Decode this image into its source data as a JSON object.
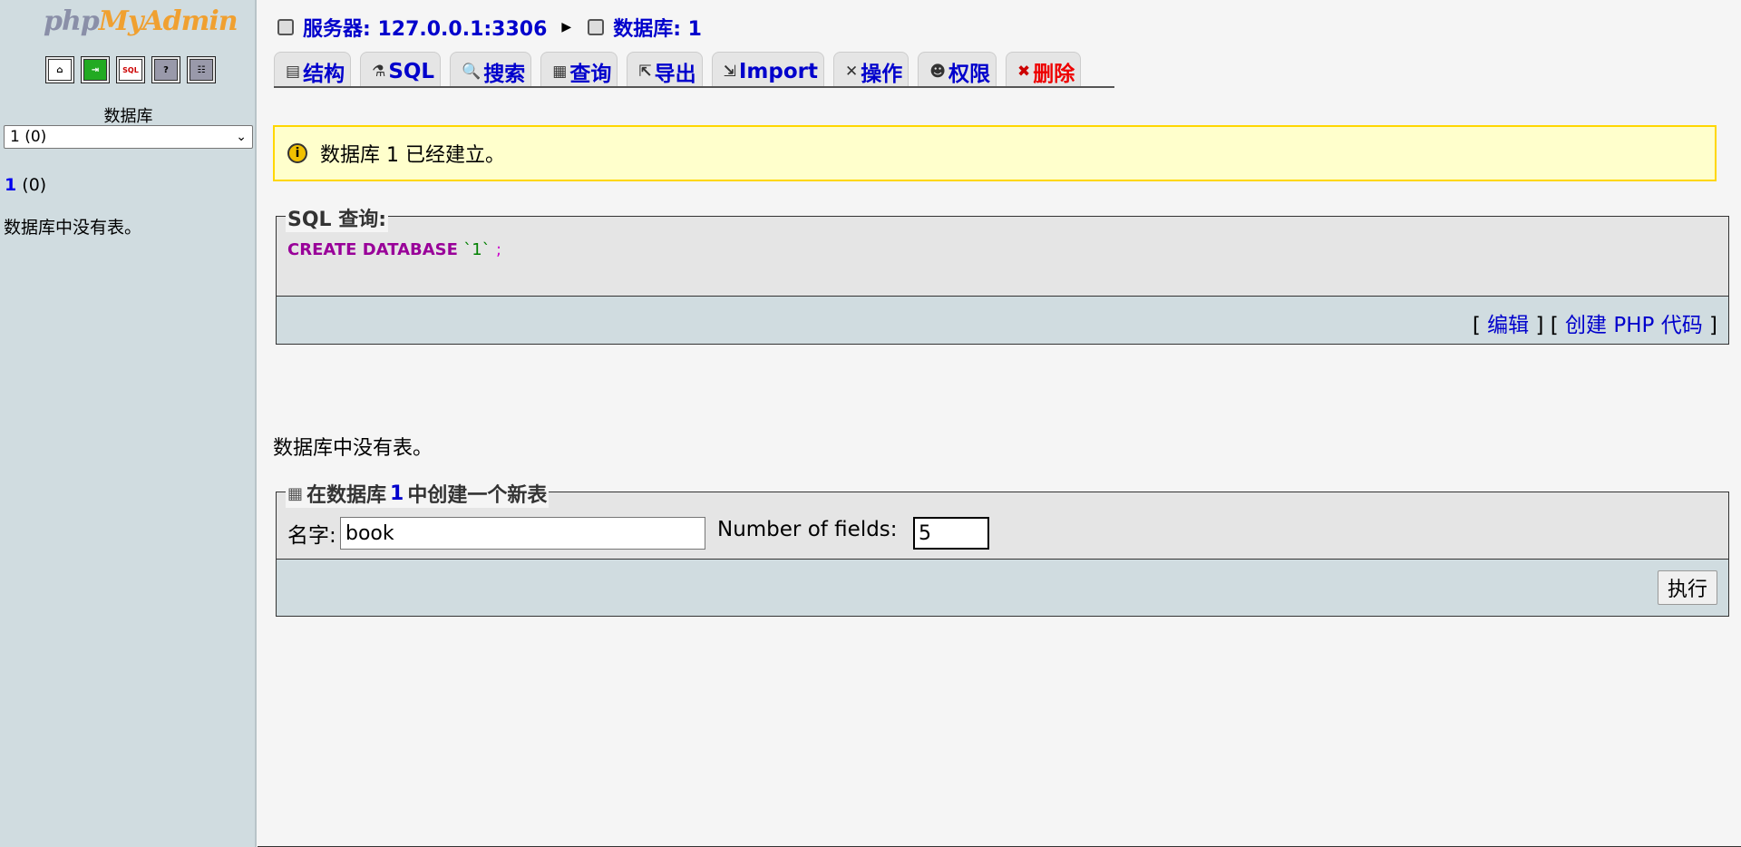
{
  "left": {
    "logo": {
      "php": "php",
      "myadmin": "MyAdmin"
    },
    "quick_icons": [
      "home-icon",
      "exit-icon",
      "sql-icon",
      "help-icon",
      "query-window-icon"
    ],
    "quick_icon_glyphs": [
      "⌂",
      "⇥",
      "SQL",
      "?",
      "☷"
    ],
    "db_label": "数据库",
    "db_select_value": "1 (0)",
    "db_link_name": "1",
    "db_link_count": "(0)",
    "empty_text": "数据库中没有表。"
  },
  "breadcrumb": {
    "server": "服务器: 127.0.0.1:3306",
    "database": "数据库: 1"
  },
  "tabs": [
    {
      "label": "结构",
      "icon": "structure-icon",
      "glyph": "▤"
    },
    {
      "label": "SQL",
      "icon": "sql-icon",
      "glyph": "⚗"
    },
    {
      "label": "搜索",
      "icon": "search-icon",
      "glyph": "🔍"
    },
    {
      "label": "查询",
      "icon": "query-icon",
      "glyph": "▦"
    },
    {
      "label": "导出",
      "icon": "export-icon",
      "glyph": "⇱"
    },
    {
      "label": "Import",
      "icon": "import-icon",
      "glyph": "⇲"
    },
    {
      "label": "操作",
      "icon": "operations-icon",
      "glyph": "✕"
    },
    {
      "label": "权限",
      "icon": "privileges-icon",
      "glyph": "☻"
    },
    {
      "label": "删除",
      "icon": "drop-icon",
      "glyph": "✖"
    }
  ],
  "notice": {
    "text": "数据库 1 已经建立。"
  },
  "sql_box": {
    "legend": "SQL 查询:",
    "keyword": "CREATE DATABASE",
    "identifier": "`1`",
    "terminator": ";",
    "edit_link": "编辑",
    "php_link": "创建 PHP 代码"
  },
  "no_tables_text": "数据库中没有表。",
  "create_table": {
    "legend_prefix": "在数据库",
    "legend_db": "1",
    "legend_suffix": "中创建一个新表",
    "name_label": "名字:",
    "name_value": "book",
    "fields_label": "Number of fields:",
    "fields_value": "5",
    "go_label": "执行"
  }
}
